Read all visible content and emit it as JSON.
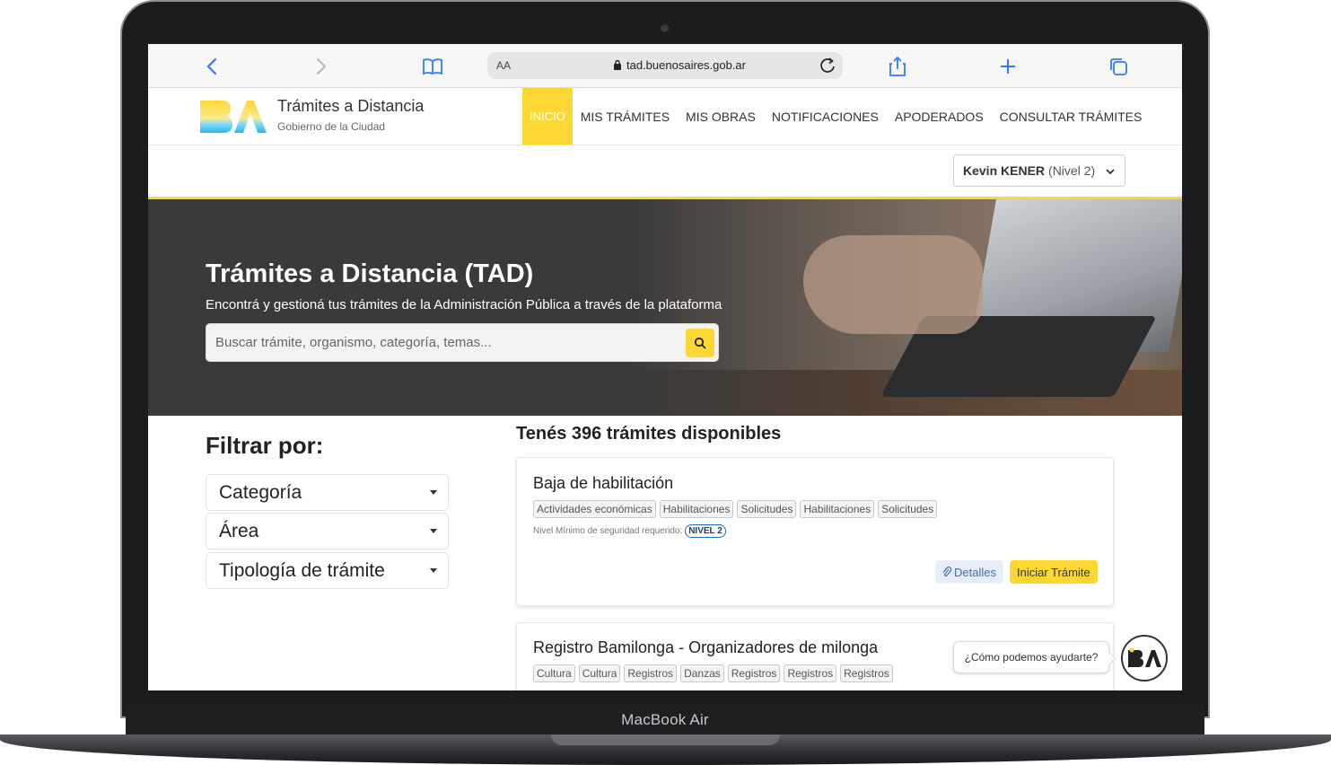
{
  "device": {
    "label": "MacBook Air"
  },
  "browser": {
    "aa_label": "AA",
    "url": "tad.buenosaires.gob.ar"
  },
  "brand": {
    "title": "Trámites a Distancia",
    "subtitle": "Gobierno de la Ciudad",
    "colors": {
      "accent": "#fdd835",
      "logo_blue": "#5ec8f0"
    }
  },
  "nav": {
    "items": [
      {
        "label": "INICIO",
        "active": true
      },
      {
        "label": "MIS TRÁMITES"
      },
      {
        "label": "MIS OBRAS"
      },
      {
        "label": "NOTIFICACIONES"
      },
      {
        "label": "APODERADOS"
      },
      {
        "label": "CONSULTAR TRÁMITES"
      }
    ]
  },
  "user": {
    "name": "Kevin KENER",
    "level": "(Nivel 2)"
  },
  "hero": {
    "title": "Trámites a Distancia (TAD)",
    "subtitle": "Encontrá y gestioná tus trámites de la Administración Pública a través de la plataforma",
    "search_placeholder": "Buscar trámite, organismo, categoría, temas..."
  },
  "filters": {
    "title": "Filtrar por:",
    "items": [
      "Categoría",
      "Área",
      "Tipología de trámite"
    ]
  },
  "results": {
    "title": "Tenés 396 trámites disponibles",
    "cards": [
      {
        "title": "Baja de habilitación",
        "tags": [
          "Actividades económicas",
          "Habilitaciones",
          "Solicitudes",
          "Habilitaciones",
          "Solicitudes"
        ],
        "security_label": "Nivel Mínimo de seguridad requerido:",
        "level": "NIVEL 2",
        "details_label": "Detalles",
        "start_label": "Iniciar Trámite"
      },
      {
        "title": "Registro Bamilonga - Organizadores de milonga",
        "tags": [
          "Cultura",
          "Cultura",
          "Registros",
          "Danzas",
          "Registros",
          "Registros",
          "Registros"
        ]
      }
    ]
  },
  "chat": {
    "prompt": "¿Cómo podemos ayudarte?"
  }
}
